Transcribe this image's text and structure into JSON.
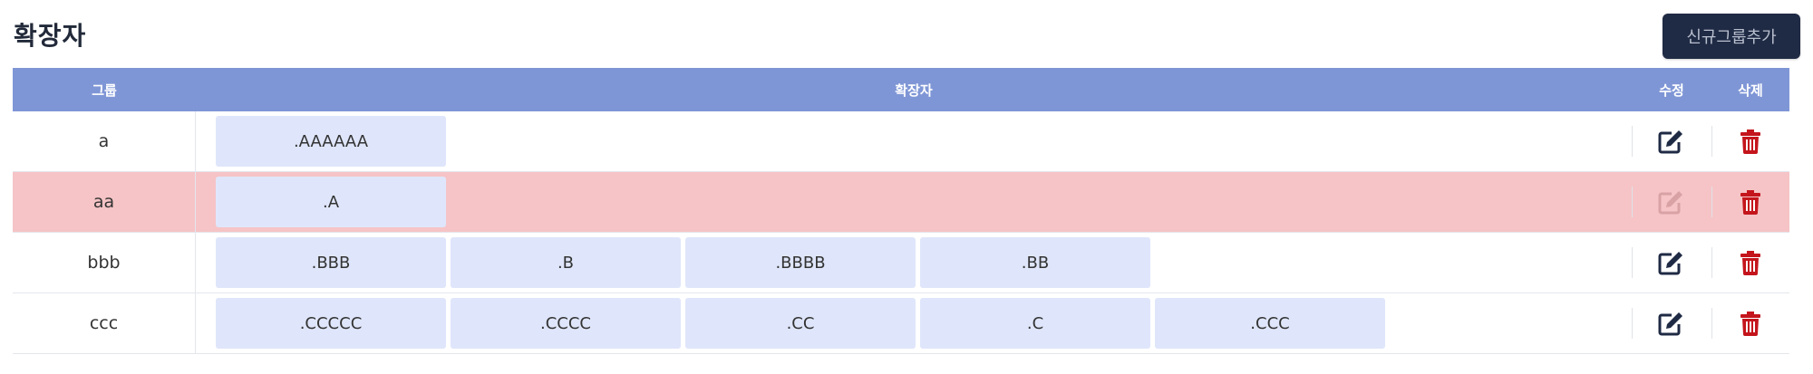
{
  "page": {
    "title": "확장자"
  },
  "toolbar": {
    "add_group_label": "신규그룹추가"
  },
  "table": {
    "headers": {
      "group": "그룹",
      "extensions": "확장자",
      "edit": "수정",
      "delete": "삭제"
    },
    "rows": [
      {
        "group": "a",
        "extensions": [
          ".AAAAAA"
        ],
        "highlighted": false,
        "edit_enabled": true
      },
      {
        "group": "aa",
        "extensions": [
          ".A"
        ],
        "highlighted": true,
        "edit_enabled": false
      },
      {
        "group": "bbb",
        "extensions": [
          ".BBB",
          ".B",
          ".BBBB",
          ".BB"
        ],
        "highlighted": false,
        "edit_enabled": true
      },
      {
        "group": "ccc",
        "extensions": [
          ".CCCCC",
          ".CCCC",
          ".CC",
          ".C",
          ".CCC"
        ],
        "highlighted": false,
        "edit_enabled": true
      }
    ]
  },
  "icons": {
    "edit": "edit-icon",
    "delete": "trash-icon"
  },
  "colors": {
    "header_bg": "#7f96d6",
    "highlight_row": "#f6c4c6",
    "chip_bg": "#dfe6fb",
    "edit_icon": "#1f2a44",
    "edit_icon_disabled": "#d9a2a5",
    "delete_icon": "#c4151c",
    "button_bg": "#1f2a44"
  }
}
